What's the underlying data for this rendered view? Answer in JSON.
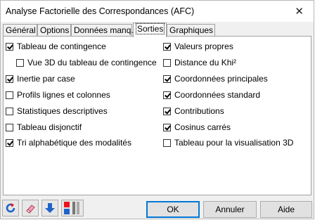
{
  "window": {
    "title": "Analyse Factorielle des Correspondances (AFC)",
    "close_symbol": "✕"
  },
  "tabs": [
    {
      "label": "Général"
    },
    {
      "label": "Options"
    },
    {
      "label": "Données manq."
    },
    {
      "label": "Sorties",
      "active": true
    },
    {
      "label": "Graphiques"
    }
  ],
  "options_left": [
    {
      "label": "Tableau de contingence",
      "checked": true
    },
    {
      "label": "Vue 3D du tableau de contingence",
      "checked": false
    },
    {
      "label": "Inertie par case",
      "checked": true
    },
    {
      "label": "Profils lignes et colonnes",
      "checked": false
    },
    {
      "label": "Statistiques descriptives",
      "checked": false
    },
    {
      "label": "Tableau disjonctif",
      "checked": false
    },
    {
      "label": "Tri alphabétique des modalités",
      "checked": true
    }
  ],
  "options_right": [
    {
      "label": "Valeurs propres",
      "checked": true
    },
    {
      "label": "Distance du Khi²",
      "checked": false
    },
    {
      "label": "Coordonnées principales",
      "checked": true
    },
    {
      "label": "Coordonnées standard",
      "checked": true
    },
    {
      "label": "Contributions",
      "checked": true
    },
    {
      "label": "Cosinus carrés",
      "checked": true
    },
    {
      "label": "Tableau pour la visualisation 3D",
      "checked": false
    }
  ],
  "toolbar_icons": [
    "reset-icon",
    "eraser-icon",
    "arrow-down-icon",
    "layout-toggle-icon"
  ],
  "buttons": {
    "ok": "OK",
    "cancel": "Annuler",
    "help": "Aide"
  },
  "colors": {
    "accent": "#0078d7",
    "arrow_blue": "#1e64c8",
    "red": "#e8141e"
  }
}
